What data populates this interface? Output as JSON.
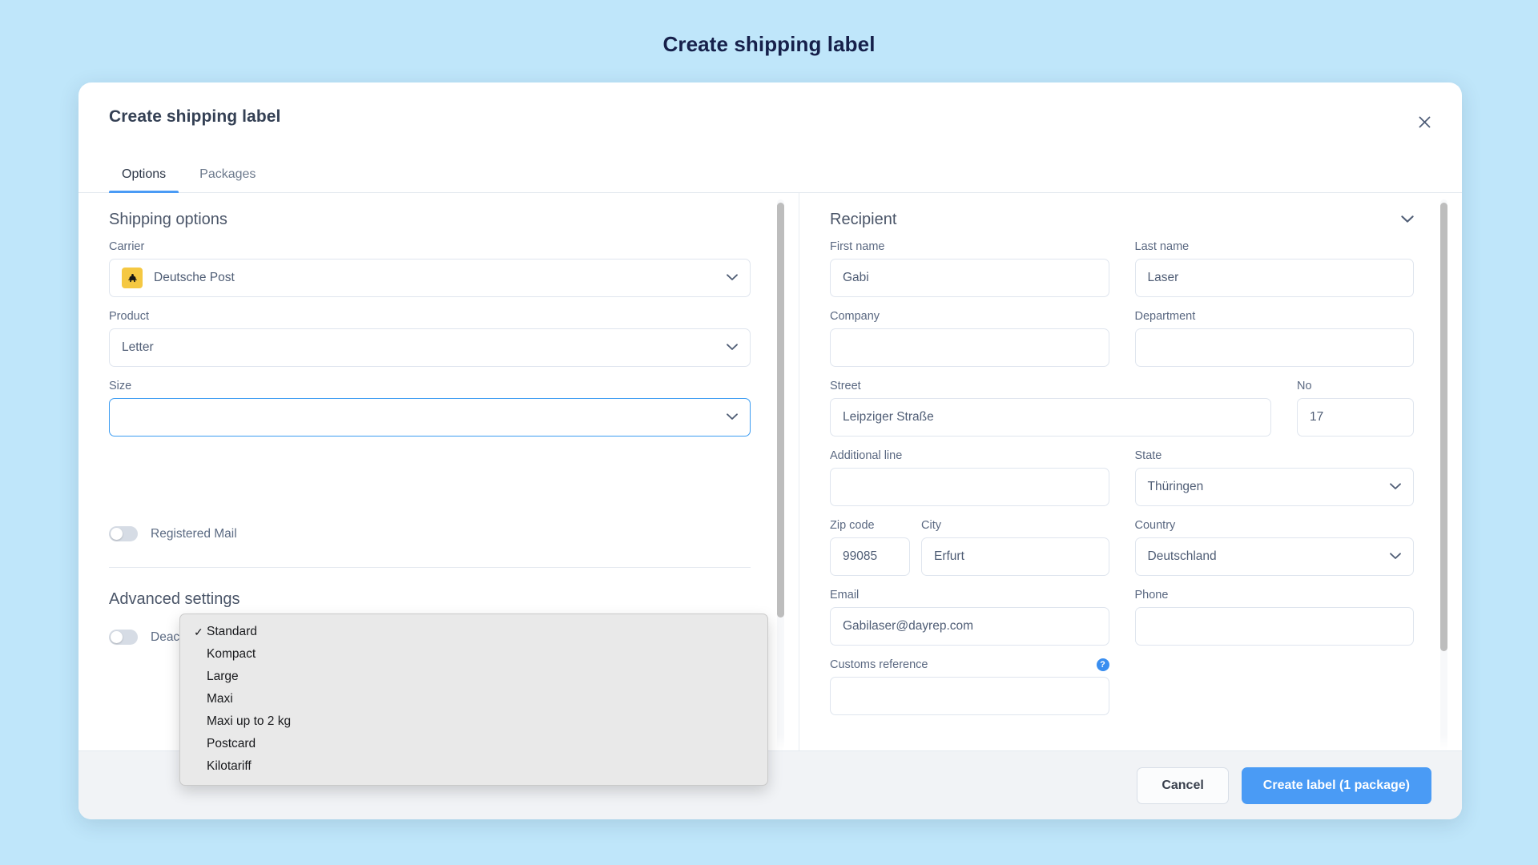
{
  "page": {
    "title": "Create shipping label",
    "background_color": "#bfe6fa",
    "title_color": "#16204a"
  },
  "modal": {
    "title": "Create shipping label",
    "close_icon": "close-icon",
    "tabs": [
      {
        "label": "Options",
        "active": true
      },
      {
        "label": "Packages",
        "active": false
      }
    ]
  },
  "shipping_options": {
    "heading": "Shipping options",
    "carrier": {
      "label": "Carrier",
      "value": "Deutsche Post",
      "logo": "deutsche-post-horn-icon",
      "logo_bg": "#f5c842"
    },
    "product": {
      "label": "Product",
      "value": "Letter"
    },
    "size": {
      "label": "Size",
      "value": "",
      "focused": true
    },
    "size_options": [
      {
        "label": "Standard",
        "selected": true
      },
      {
        "label": "Kompact",
        "selected": false
      },
      {
        "label": "Large",
        "selected": false
      },
      {
        "label": "Maxi",
        "selected": false
      },
      {
        "label": "Maxi up to 2 kg",
        "selected": false
      },
      {
        "label": "Postcard",
        "selected": false
      },
      {
        "label": "Kilotariff",
        "selected": false
      }
    ],
    "registered_mail": {
      "label": "Registered Mail",
      "on": false
    }
  },
  "advanced_settings": {
    "heading": "Advanced settings",
    "deactivate_weight_check": {
      "label": "Deactivate weight check",
      "on": false
    }
  },
  "recipient": {
    "heading": "Recipient",
    "collapse_icon": "chevron-down-icon",
    "fields": {
      "first_name": {
        "label": "First name",
        "value": "Gabi"
      },
      "last_name": {
        "label": "Last name",
        "value": "Laser"
      },
      "company": {
        "label": "Company",
        "value": ""
      },
      "department": {
        "label": "Department",
        "value": ""
      },
      "street": {
        "label": "Street",
        "value": "Leipziger Straße"
      },
      "no": {
        "label": "No",
        "value": "17"
      },
      "additional_line": {
        "label": "Additional line",
        "value": ""
      },
      "state": {
        "label": "State",
        "value": "Thüringen"
      },
      "zip_code": {
        "label": "Zip code",
        "value": "99085"
      },
      "city": {
        "label": "City",
        "value": "Erfurt"
      },
      "country": {
        "label": "Country",
        "value": "Deutschland"
      },
      "email": {
        "label": "Email",
        "value": "Gabilaser@dayrep.com"
      },
      "phone": {
        "label": "Phone",
        "value": ""
      },
      "customs_reference": {
        "label": "Customs reference",
        "value": "",
        "help_icon": "help-question-icon"
      }
    }
  },
  "footer": {
    "cancel_label": "Cancel",
    "create_label": "Create label (1 package)",
    "primary_color": "#4a9bf5"
  }
}
